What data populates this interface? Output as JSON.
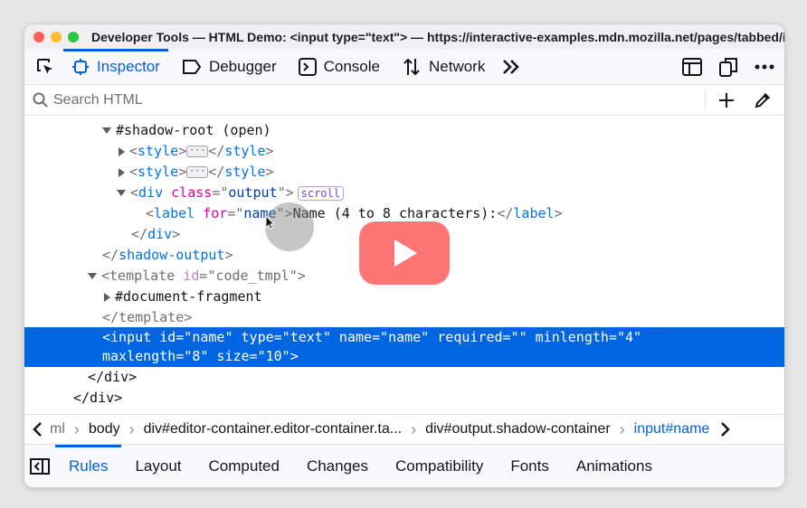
{
  "window": {
    "title": "Developer Tools — HTML Demo: <input type=\"text\"> — https://interactive-examples.mdn.mozilla.net/pages/tabbed/inp...",
    "lights": [
      "#ff5f57",
      "#febc2e",
      "#28c840"
    ]
  },
  "toolbar": {
    "tabs": [
      {
        "label": "Inspector",
        "icon": "inspector-icon",
        "active": true
      },
      {
        "label": "Debugger",
        "icon": "debugger-icon"
      },
      {
        "label": "Console",
        "icon": "console-icon"
      },
      {
        "label": "Network",
        "icon": "network-icon"
      }
    ],
    "overflow_icon": "double-chevron-right-icon",
    "right_icons": [
      "responsive-design-icon",
      "dock-icon",
      "more-options-icon"
    ],
    "accent": "#0061e0"
  },
  "search": {
    "placeholder": "Search HTML",
    "value": "",
    "add_icon": "plus-icon",
    "picker_icon": "eyedropper-icon"
  },
  "tree": {
    "shadow_root": "#shadow-root (open)",
    "style_tag": "style",
    "div_tag": "div",
    "class_attr": "class",
    "output_val": "output",
    "scroll_badge": "scroll",
    "label_tag": "label",
    "for_attr": "for",
    "name_val": "name",
    "label_text": "Name (4 to 8 characters):",
    "shadow_output_tag": "shadow-output",
    "template_tag": "template",
    "id_attr": "id",
    "code_tmpl_val": "code_tmpl",
    "document_fragment": "#document-fragment",
    "input_line1": "<input id=\"name\" type=\"text\" name=\"name\" required=\"\" minlength=\"4\"",
    "input_line2": "maxlength=\"8\" size=\"10\">",
    "div_close": "</div>",
    "selection_color": "#0065e1"
  },
  "breadcrumbs": {
    "items": [
      "ml",
      "body",
      "div#editor-container.editor-container.ta...",
      "div#output.shadow-container",
      "input#name"
    ],
    "current_index": 4
  },
  "sidetabs": {
    "items": [
      "Rules",
      "Layout",
      "Computed",
      "Changes",
      "Compatibility",
      "Fonts",
      "Animations"
    ],
    "active_index": 0
  },
  "overlay": {
    "play_color": "#ff5d5d"
  }
}
